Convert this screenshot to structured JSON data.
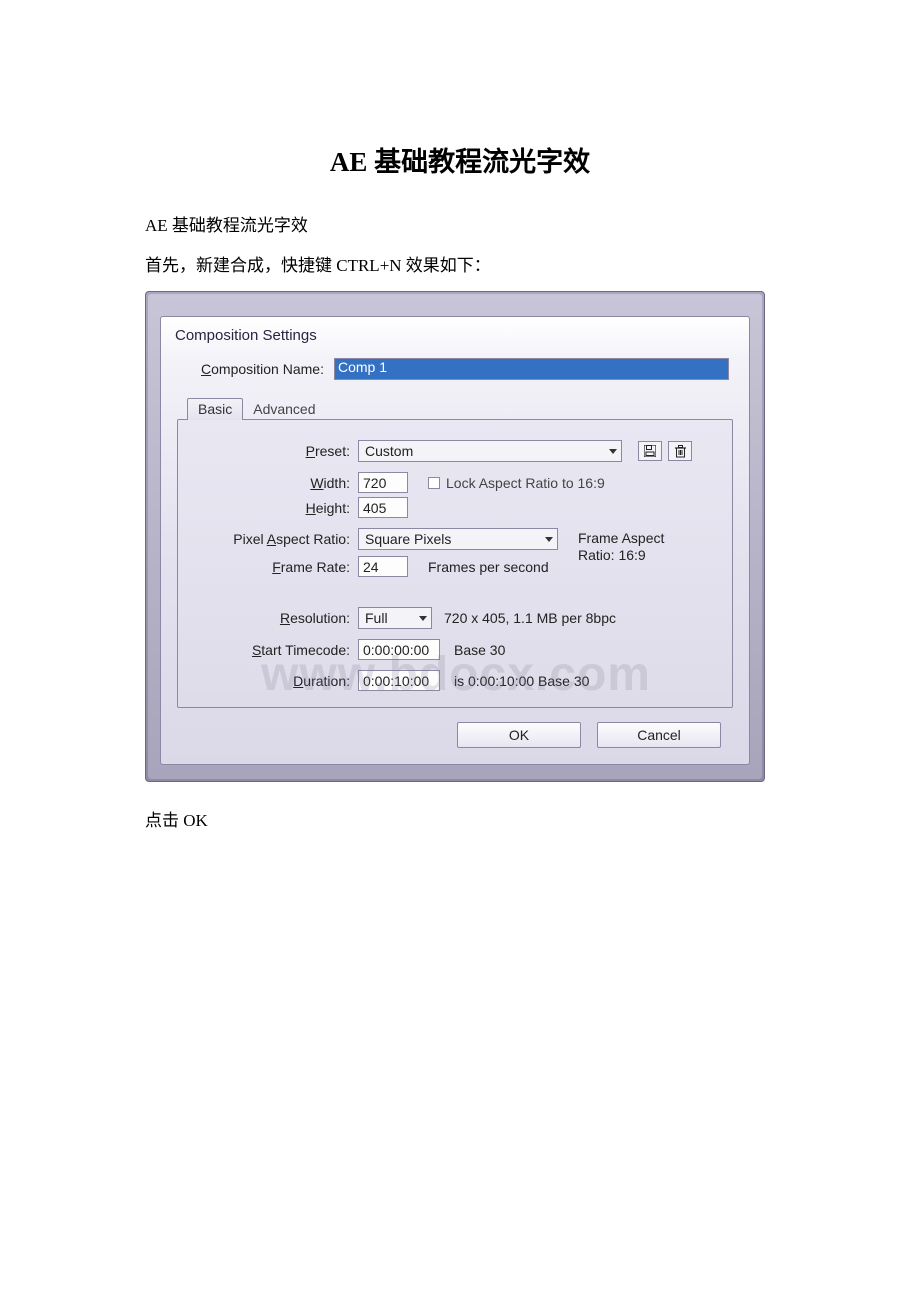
{
  "doc": {
    "title": "AE 基础教程流光字效",
    "p1": "AE 基础教程流光字效",
    "p2": "首先，新建合成，快捷键 CTRL+N 效果如下：",
    "p3": "点击 OK"
  },
  "dialog": {
    "title": "Composition Settings",
    "comp_name_label_pre": "C",
    "comp_name_label_rest": "omposition Name:",
    "comp_name_value": "Comp 1",
    "tabs": {
      "basic": "Basic",
      "advanced": "Advanced"
    },
    "preset": {
      "label_pre": "P",
      "label_rest": "reset:",
      "value": "Custom"
    },
    "width": {
      "label_pre": "W",
      "label_rest": "idth:",
      "value": "720"
    },
    "height": {
      "label_pre": "H",
      "label_rest": "eight:",
      "value": "405"
    },
    "lock_aspect": "Lock Aspect Ratio to 16:9",
    "par": {
      "label_pre": "Pixel ",
      "label_u": "A",
      "label_rest": "spect Ratio:",
      "value": "Square Pixels"
    },
    "frame_aspect": {
      "line1": "Frame Aspect",
      "line2": "Ratio: 16:9"
    },
    "frame_rate": {
      "label_pre": "F",
      "label_rest": "rame Rate:",
      "value": "24",
      "suffix": "Frames per second"
    },
    "resolution": {
      "label_pre": "R",
      "label_rest": "esolution:",
      "value": "Full",
      "info": "720 x 405,  1.1 MB per 8bpc"
    },
    "start_tc": {
      "label_pre": "S",
      "label_rest": "tart Timecode:",
      "value": "0:00:00:00",
      "suffix": "Base 30"
    },
    "duration": {
      "label_pre": "D",
      "label_rest": "uration:",
      "value": "0:00:10:00",
      "suffix": "is 0:00:10:00  Base 30"
    },
    "buttons": {
      "ok": "OK",
      "cancel": "Cancel"
    }
  },
  "watermark": "www.bdocx.com"
}
